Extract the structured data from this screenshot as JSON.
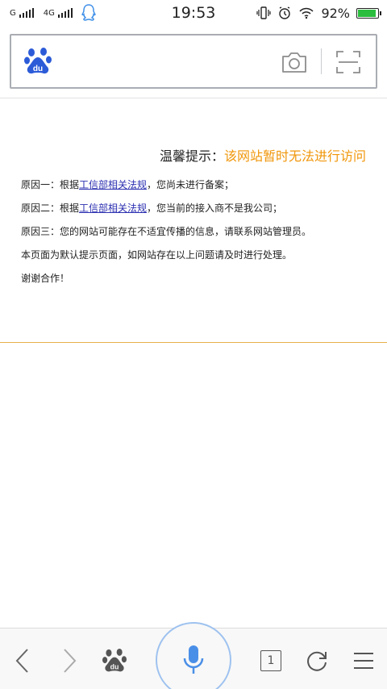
{
  "status_bar": {
    "carrier_1": "G",
    "network_2": "4G",
    "time": "19:53",
    "battery_percent": "92%",
    "battery_level": 0.92,
    "icons": [
      "signal-icon",
      "qq-icon",
      "vibrate-icon",
      "alarm-icon",
      "wifi-icon",
      "battery-icon"
    ]
  },
  "search": {
    "logo_icon": "baidu-paw-icon",
    "camera_icon": "camera-icon",
    "scan_icon": "scan-icon"
  },
  "notice": {
    "title_label": "温馨提示：",
    "title_message": "该网站暂时无法进行访问",
    "lines": [
      {
        "prefix": "原因一：根据",
        "link": "工信部相关法规",
        "suffix": "，您尚未进行备案；"
      },
      {
        "prefix": "原因二：根据",
        "link": "工信部相关法规",
        "suffix": "，您当前的接入商不是我公司；"
      },
      {
        "text": "原因三：您的网站可能存在不适宜传播的信息，请联系网站管理员。"
      },
      {
        "text": "本页面为默认提示页面，如网站存在以上问题请及时进行处理。"
      },
      {
        "text": "谢谢合作！"
      }
    ]
  },
  "toolbar": {
    "tab_count": "1",
    "colors": {
      "voice_accent": "#4a8fe7",
      "warning_orange": "#f0960a",
      "link_blue": "#2b2fb0"
    }
  }
}
